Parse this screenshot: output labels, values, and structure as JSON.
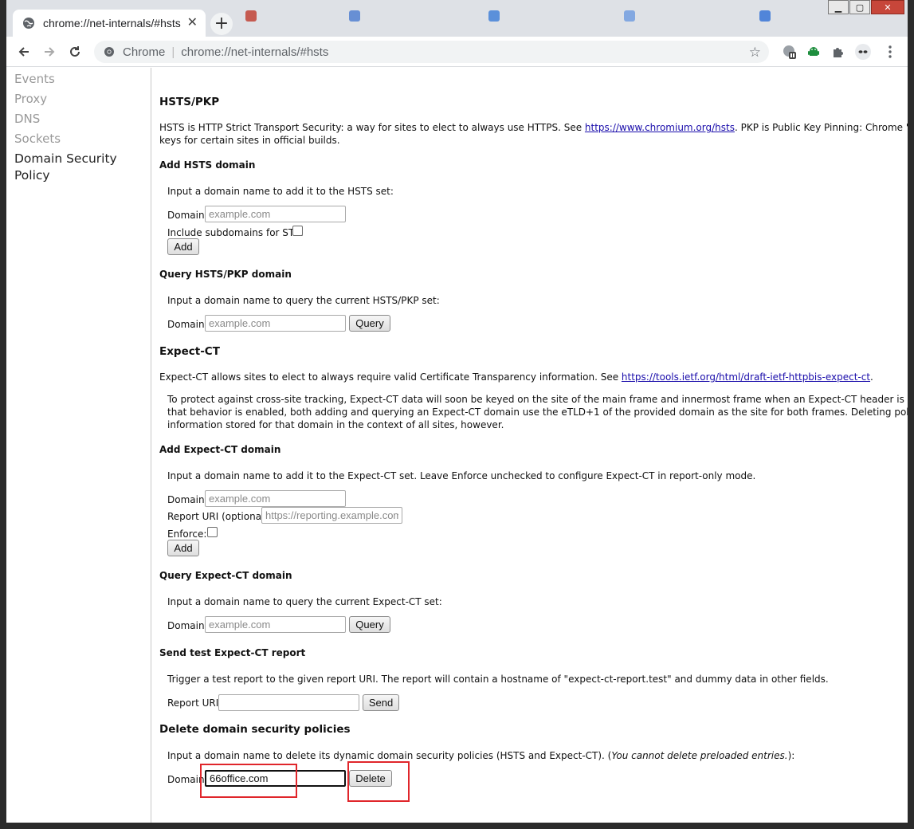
{
  "browser": {
    "tab_title": "chrome://net-internals/#hsts",
    "new_tab_symbol": "+",
    "omnibox_scheme_label": "Chrome",
    "omnibox_separator": "|",
    "omnibox_url": "chrome://net-internals/#hsts"
  },
  "sidebar": {
    "items": [
      {
        "label": "Events"
      },
      {
        "label": "Proxy"
      },
      {
        "label": "DNS"
      },
      {
        "label": "Sockets"
      },
      {
        "label": "Domain Security Policy"
      }
    ],
    "active_index": 4
  },
  "hsts": {
    "heading": "HSTS/PKP",
    "desc_before_link": "HSTS is HTTP Strict Transport Security: a way for sites to elect to always use HTTPS. See ",
    "desc_link": "https://www.chromium.org/hsts",
    "desc_after_link": ". PKP is Public Key Pinning: Chrome \"pins\" certain public",
    "desc_line2": "keys for certain sites in official builds.",
    "add": {
      "heading": "Add HSTS domain",
      "instruction": "Input a domain name to add it to the HSTS set:",
      "domain_label": "Domain:",
      "domain_placeholder": "example.com",
      "subdomains_label": "Include subdomains for STS:",
      "add_button": "Add"
    },
    "query": {
      "heading": "Query HSTS/PKP domain",
      "instruction": "Input a domain name to query the current HSTS/PKP set:",
      "domain_label": "Domain:",
      "domain_placeholder": "example.com",
      "query_button": "Query"
    }
  },
  "expect_ct": {
    "heading": "Expect-CT",
    "desc_before_link": "Expect-CT allows sites to elect to always require valid Certificate Transparency information. See ",
    "desc_link": "https://tools.ietf.org/html/draft-ietf-httpbis-expect-ct",
    "desc_after_link": ".",
    "note_line1": "To protect against cross-site tracking, Expect-CT data will soon be keyed on the site of the main frame and innermost frame when an Expect-CT header is encountered. When",
    "note_line2": "that behavior is enabled, both adding and querying an Expect-CT domain use the eTLD+1 of the provided domain as the site for both frames. Deleting policies affects",
    "note_line3": "information stored for that domain in the context of all sites, however.",
    "add": {
      "heading": "Add Expect-CT domain",
      "instruction": "Input a domain name to add it to the Expect-CT set. Leave Enforce unchecked to configure Expect-CT in report-only mode.",
      "domain_label": "Domain:",
      "domain_placeholder": "example.com",
      "report_uri_label": "Report URI (optional):",
      "report_uri_placeholder": "https://reporting.example.com",
      "enforce_label": "Enforce:",
      "add_button": "Add"
    },
    "query": {
      "heading": "Query Expect-CT domain",
      "instruction": "Input a domain name to query the current Expect-CT set:",
      "domain_label": "Domain:",
      "domain_placeholder": "example.com",
      "query_button": "Query"
    },
    "test_report": {
      "heading": "Send test Expect-CT report",
      "instruction": "Trigger a test report to the given report URI. The report will contain a hostname of \"expect-ct-report.test\" and dummy data in other fields.",
      "report_uri_label": "Report URI:",
      "report_uri_value": "",
      "send_button": "Send"
    }
  },
  "delete": {
    "heading": "Delete domain security policies",
    "instruction_before": "Input a domain name to delete its dynamic domain security policies (HSTS and Expect-CT). (",
    "instruction_italic": "You cannot delete preloaded entries.",
    "instruction_after": "):",
    "domain_label": "Domain:",
    "domain_value": "66office.com",
    "delete_button": "Delete"
  },
  "colors": {
    "highlight_box": "#e0262b",
    "link": "#1a0dab"
  }
}
